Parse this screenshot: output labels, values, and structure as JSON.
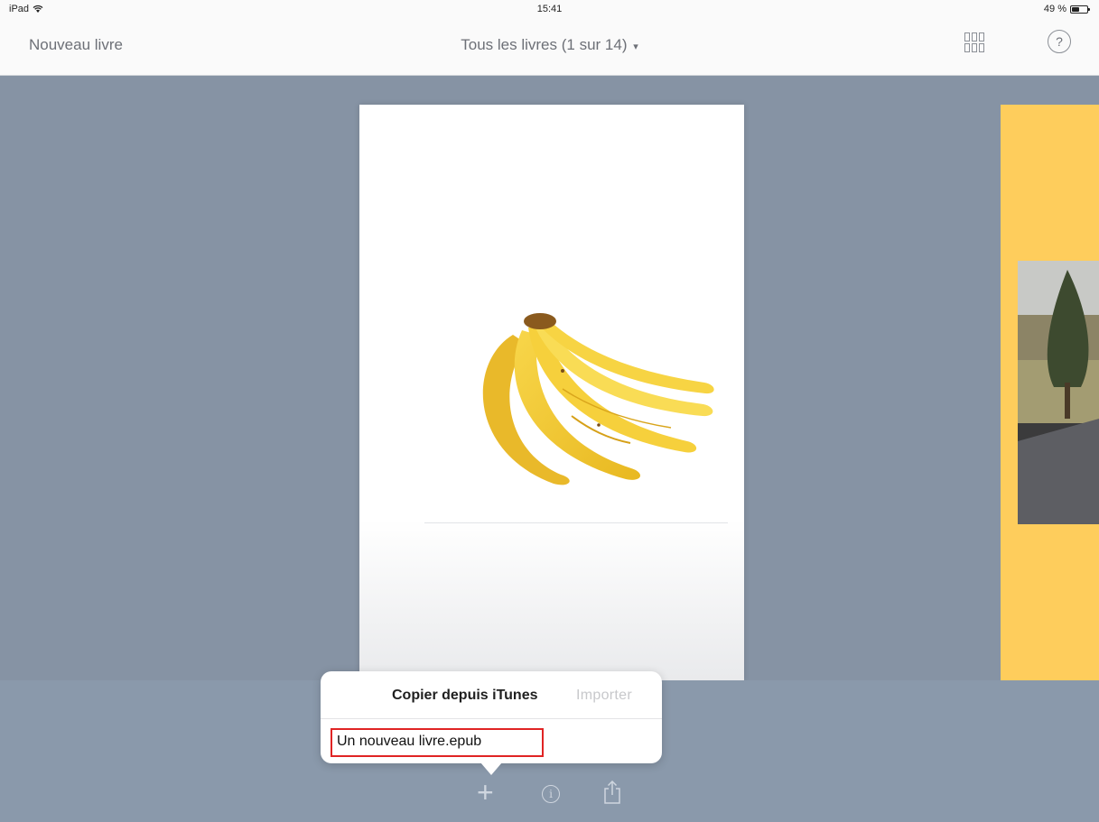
{
  "status_bar": {
    "device": "iPad",
    "wifi_icon": "wifi-icon",
    "time": "15:41",
    "battery_percent_label": "49 %",
    "battery_level": 0.49
  },
  "nav_bar": {
    "left_label": "Nouveau livre",
    "title": "Tous les livres (1 sur 14)",
    "title_caret": "▾",
    "grid_icon": "grid-view-icon",
    "help_label": "?"
  },
  "popover": {
    "title": "Copier depuis iTunes",
    "import_label": "Importer",
    "items": [
      {
        "label": "Un nouveau livre.epub"
      }
    ]
  },
  "toolbar": {
    "add_label": "+",
    "info_label": "i",
    "share_icon": "share-icon"
  },
  "colors": {
    "background": "#8693a4",
    "highlight_border": "#e02424",
    "next_book_cover": "#fecd5c"
  }
}
